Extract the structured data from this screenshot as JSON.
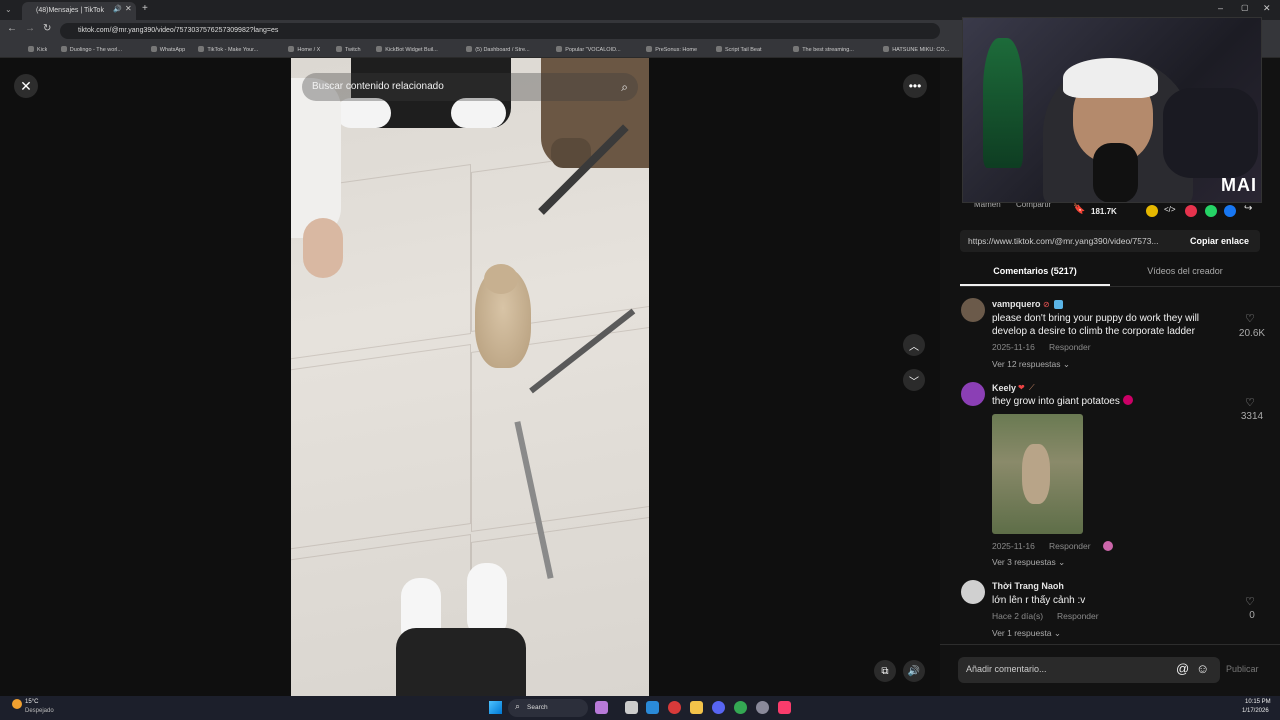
{
  "browser": {
    "tab_title": "(48)Mensajes | TikTok",
    "url": "tiktok.com/@mr.yang390/video/7573037576257309982?lang=es",
    "bookmarks": [
      "Kick",
      "Duolingo - The worl...",
      "WhatsApp",
      "TikTok - Make Your...",
      "Home / X",
      "Twitch",
      "KickBot Widget Buil...",
      "(5) Dashboard / Stre...",
      "Popular \"VOCALOID...",
      "PreSonus: Home",
      "Script Tail Beat",
      "The best streaming...",
      "HATSUNE MIKU: CO...",
      "Animated Subtitles...",
      "HATSUNE M..."
    ]
  },
  "viewer": {
    "search_placeholder": "Buscar contenido relacionado",
    "close_icon": "close-icon",
    "more_icon": "more-dots-icon"
  },
  "actions": {
    "author_label": "Mamen",
    "share_label": "Compartir",
    "bookmarks_count": "181.7K",
    "link_url": "https://www.tiktok.com/@mr.yang390/video/7573...",
    "copy_link": "Copiar enlace"
  },
  "tabs": {
    "comments": "Comentarios (5217)",
    "creator_videos": "Vídeos del creador"
  },
  "comments": [
    {
      "user": "vampquero",
      "text": "please don't bring your puppy do work they will develop a desire to climb the corporate ladder",
      "date": "2025-11-16",
      "reply": "Responder",
      "likes": "20.6K",
      "replies": "Ver 12 respuestas",
      "avatar_color": "#6b5a4a"
    },
    {
      "user": "Keely",
      "text": "they grow into giant potatoes",
      "date": "2025-11-16",
      "reply": "Responder",
      "likes": "3314",
      "replies": "Ver 3 respuestas",
      "avatar_color": "#8b3fb5"
    },
    {
      "user": "Thời Trang Naoh",
      "text": "lớn lên r thấy cảnh :v",
      "date": "Hace 2 día(s)",
      "reply": "Responder",
      "likes": "0",
      "replies": "Ver 1 respuesta",
      "avatar_color": "#d0d0d0"
    }
  ],
  "composer": {
    "placeholder": "Añadir comentario...",
    "publish": "Publicar"
  },
  "webcam": {
    "overlay_text": "MAI"
  },
  "taskbar": {
    "weather_temp": "15°C",
    "weather_desc": "Despejado",
    "search": "Search",
    "time": "10:15 PM",
    "date": "1/17/2026"
  }
}
